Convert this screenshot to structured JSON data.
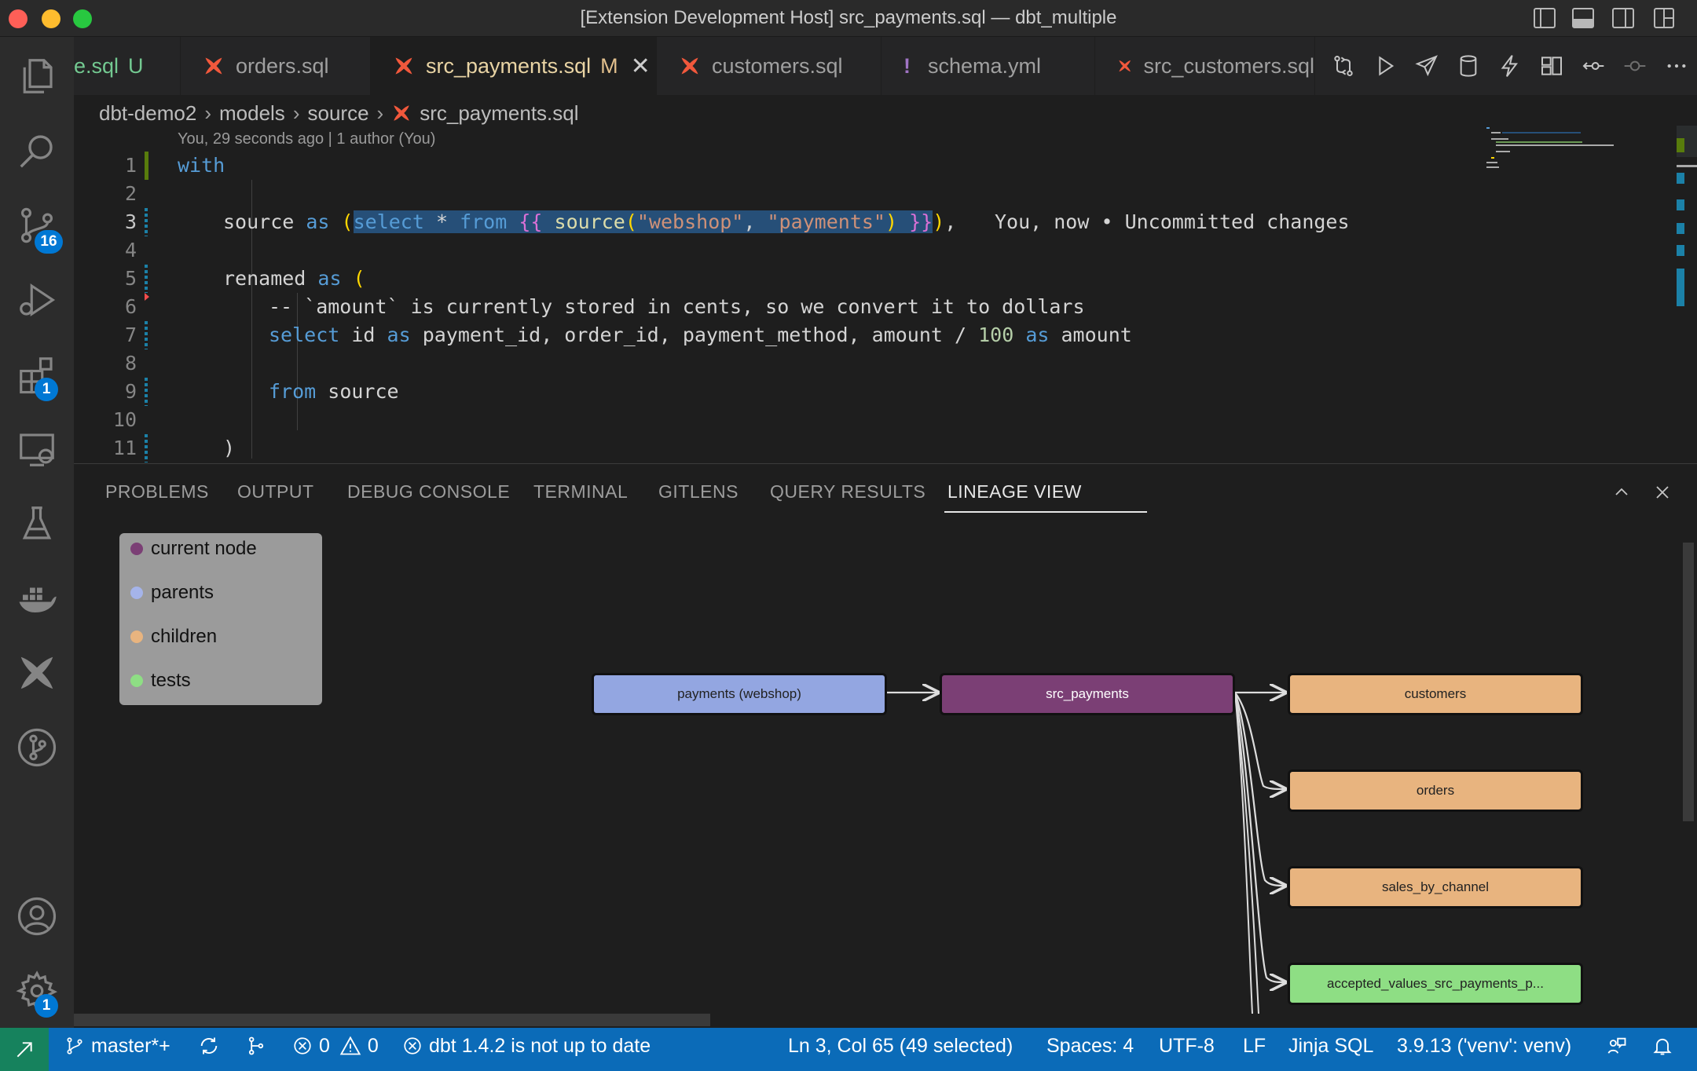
{
  "window": {
    "title": "[Extension Development Host] src_payments.sql — dbt_multiple"
  },
  "activity_bar": {
    "source_control_badge": "16",
    "extensions_badge": "1",
    "settings_badge": "1"
  },
  "tabs": [
    {
      "label": "e.sql",
      "status": "U"
    },
    {
      "label": "orders.sql",
      "status": ""
    },
    {
      "label": "src_payments.sql",
      "status": "M",
      "active": true
    },
    {
      "label": "customers.sql",
      "status": ""
    },
    {
      "label": "schema.yml",
      "status": "",
      "prefix": "!"
    },
    {
      "label": "src_customers.sql",
      "status": ""
    }
  ],
  "breadcrumb": [
    "dbt-demo2",
    "models",
    "source",
    "src_payments.sql"
  ],
  "editor": {
    "blame_header": "You, 29 seconds ago | 1 author (You)",
    "inline_blame": "You, now • Uncommitted changes",
    "line_numbers": [
      "1",
      "2",
      "3",
      "4",
      "5",
      "6",
      "7",
      "8",
      "9",
      "10",
      "11"
    ],
    "tokens": {
      "l1": {
        "with": "with"
      },
      "l3": {
        "a": "source ",
        "b": "as",
        "c": " ",
        "d": "(",
        "e": "select",
        "f": " * ",
        "g": "from",
        "h": " ",
        "i": "{{",
        "j": " ",
        "k": "source",
        "l": "(",
        "m": "\"webshop\"",
        "n": ", ",
        "o": "\"payments\"",
        "p": ") ",
        "q": "}}",
        "r": ")",
        "s": ","
      },
      "l5": {
        "a": "renamed ",
        "b": "as",
        "c": " ("
      },
      "l6": {
        "a": "-- `amount` is currently stored in cents, so we convert it to dollars"
      },
      "l7": {
        "a": "select",
        "b": " id ",
        "c": "as",
        "d": " payment_id, order_id, payment_method, amount / ",
        "e": "100",
        "f": " ",
        "g": "as",
        "h": " amount"
      },
      "l9": {
        "a": "from",
        "b": " source"
      },
      "l11": {
        "a": ")"
      }
    }
  },
  "panel": {
    "tabs": [
      "PROBLEMS",
      "OUTPUT",
      "DEBUG CONSOLE",
      "TERMINAL",
      "GITLENS",
      "QUERY RESULTS",
      "LINEAGE VIEW"
    ],
    "active_tab": "LINEAGE VIEW",
    "legend": [
      {
        "label": "current node",
        "color": "#7b3f75"
      },
      {
        "label": "parents",
        "color": "#a5b4ea"
      },
      {
        "label": "children",
        "color": "#e8b47f"
      },
      {
        "label": "tests",
        "color": "#8ede84"
      }
    ],
    "lineage": {
      "nodes": [
        {
          "id": "payments",
          "label": "payments (webshop)",
          "kind": "parent",
          "color": "#93a6e1"
        },
        {
          "id": "src_payments",
          "label": "src_payments",
          "kind": "current",
          "color": "#7b3f75"
        },
        {
          "id": "customers",
          "label": "customers",
          "kind": "child",
          "color": "#e8b47f"
        },
        {
          "id": "orders",
          "label": "orders",
          "kind": "child",
          "color": "#e8b47f"
        },
        {
          "id": "sales_by_channel",
          "label": "sales_by_channel",
          "kind": "child",
          "color": "#e8b47f"
        },
        {
          "id": "accepted_values",
          "label": "accepted_values_src_payments_p...",
          "kind": "test",
          "color": "#8ede84"
        }
      ],
      "edges": [
        [
          "payments",
          "src_payments"
        ],
        [
          "src_payments",
          "customers"
        ],
        [
          "src_payments",
          "orders"
        ],
        [
          "src_payments",
          "sales_by_channel"
        ],
        [
          "src_payments",
          "accepted_values"
        ]
      ]
    }
  },
  "status_bar": {
    "branch": "master*+",
    "errors": "0",
    "warnings": "0",
    "dbt_status": "dbt 1.4.2 is not up to date",
    "cursor": "Ln 3, Col 65 (49 selected)",
    "spaces": "Spaces: 4",
    "encoding": "UTF-8",
    "eol": "LF",
    "language": "Jinja SQL",
    "python": "3.9.13 ('venv': venv)"
  }
}
